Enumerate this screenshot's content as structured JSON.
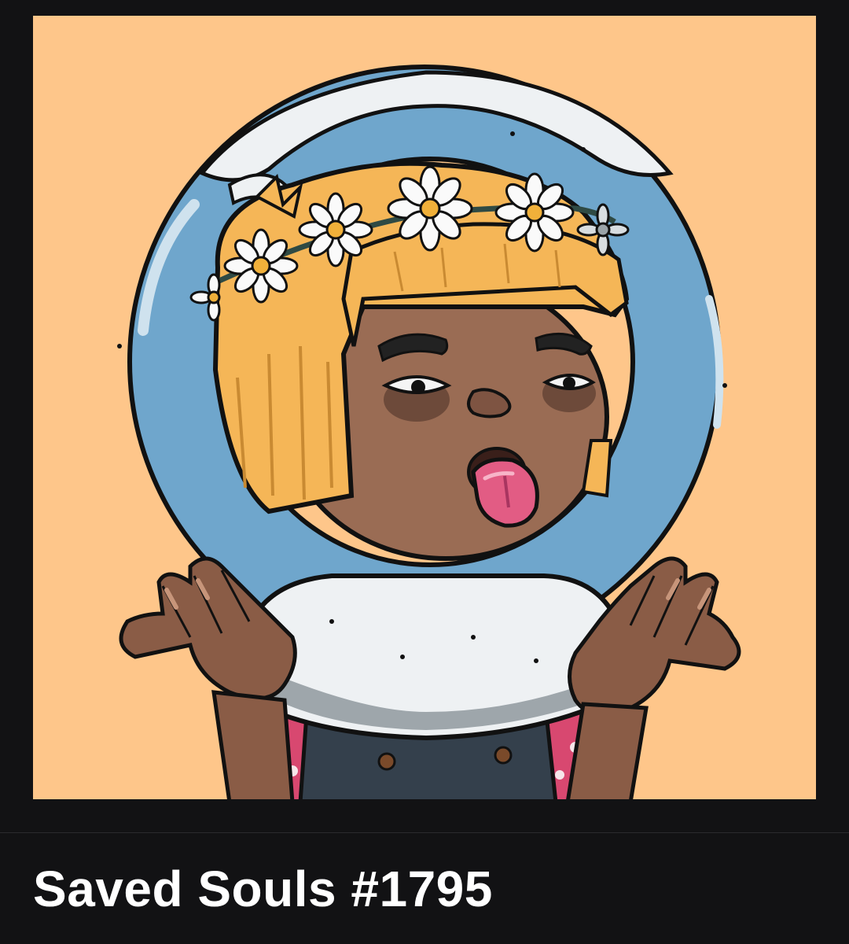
{
  "card": {
    "title": "Saved Souls #1795",
    "artwork_icon": "avatar-illustration-icon",
    "colors": {
      "page_background": "#121214",
      "art_background": "#fec68a",
      "ring_blue": "#6fa6cc",
      "ring_white": "#eef1f3",
      "skin": "#9a6c54",
      "hair": "#f5b657",
      "tongue": "#e25c84",
      "shirt_pink": "#d84870",
      "overalls": "#34404c",
      "title_text": "#ffffff"
    }
  }
}
